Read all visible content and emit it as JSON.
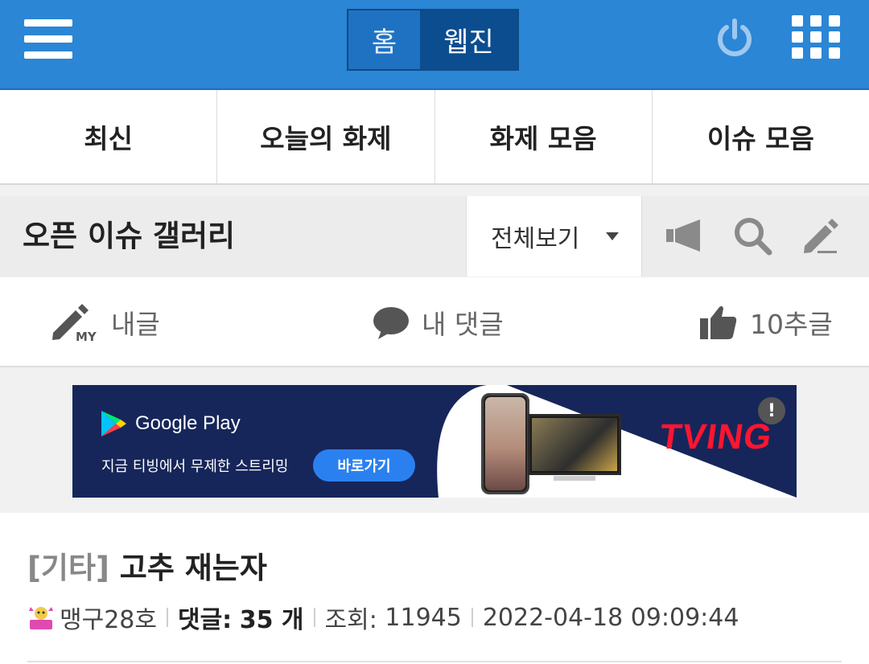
{
  "header": {
    "menu_icon": "hamburger-menu-icon",
    "mode_tabs": [
      {
        "label": "홈",
        "active": false
      },
      {
        "label": "웹진",
        "active": true
      }
    ],
    "power_icon": "power-icon",
    "apps_icon": "apps-grid-icon",
    "colors": {
      "bar": "#2b86d6",
      "toggle_active": "#0b4d8f"
    }
  },
  "nav_tabs": [
    {
      "label": "최신"
    },
    {
      "label": "오늘의 화제"
    },
    {
      "label": "화제 모음"
    },
    {
      "label": "이슈 모음"
    }
  ],
  "gallery": {
    "title": "오픈 이슈 갤러리",
    "filter_value": "전체보기",
    "icons": [
      "megaphone-icon",
      "search-icon",
      "pencil-icon"
    ]
  },
  "my_links": [
    {
      "icon": "pencil-my-icon",
      "label": "내글"
    },
    {
      "icon": "speech-bubble-icon",
      "label": "내 댓글"
    },
    {
      "icon": "thumbs-up-icon",
      "label": "10추글"
    }
  ],
  "ad": {
    "store_label": "Google Play",
    "subtitle": "지금 티빙에서 무제한 스트리밍",
    "cta_label": "바로가기",
    "brand": "TVING",
    "info_label": "!",
    "colors": {
      "background": "#16265a",
      "cta": "#2b80f0",
      "brand": "#ff1530"
    }
  },
  "post": {
    "category": "[기타]",
    "title": "고추 재는자",
    "author": "맹구28호",
    "comments_label": "댓글:",
    "comments_count": "35 개",
    "views_label": "조회:",
    "views": "11945",
    "datetime": "2022-04-18 09:09:44"
  }
}
